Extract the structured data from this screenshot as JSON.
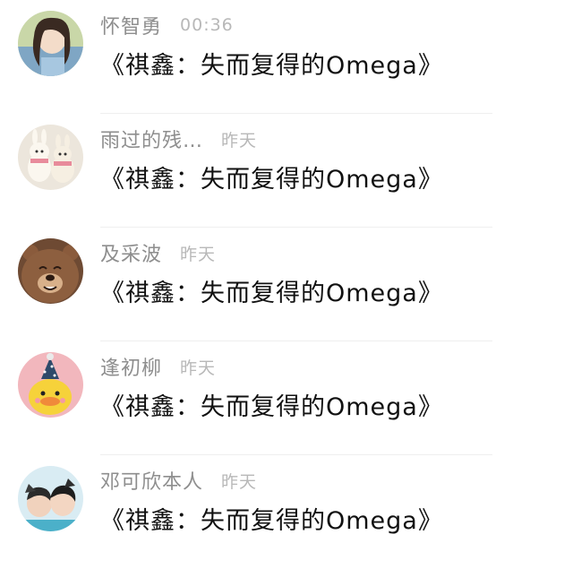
{
  "comments": [
    {
      "name": "怀智勇",
      "time": "00:36",
      "message": "《祺鑫：失而复得的Omega》",
      "avatar": "photo-avatar"
    },
    {
      "name": "雨过的残…",
      "time": "昨天",
      "message": "《祺鑫：失而复得的Omega》",
      "avatar": "plush-bunnies-avatar"
    },
    {
      "name": "及采波",
      "time": "昨天",
      "message": "《祺鑫：失而复得的Omega》",
      "avatar": "cartoon-bear-avatar"
    },
    {
      "name": "逢初柳",
      "time": "昨天",
      "message": "《祺鑫：失而复得的Omega》",
      "avatar": "yellow-duck-avatar"
    },
    {
      "name": "邓可欣本人",
      "time": "昨天",
      "message": "《祺鑫：失而复得的Omega》",
      "avatar": "kids-photo-avatar"
    }
  ],
  "colors": {
    "name": "#8e8e8e",
    "time": "#b8b8b8",
    "message": "#111111",
    "divider": "#efefef"
  }
}
